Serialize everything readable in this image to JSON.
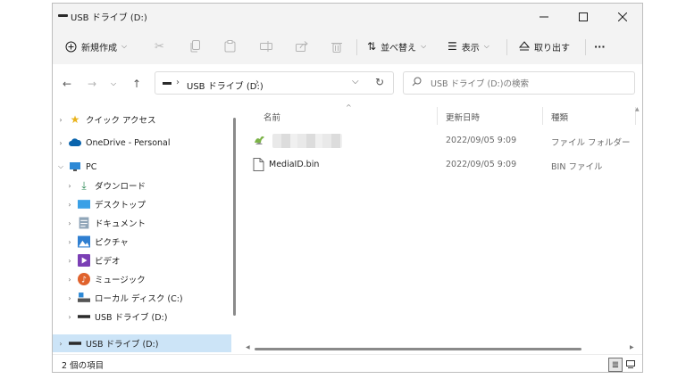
{
  "window": {
    "title": "USB ドライブ (D:)"
  },
  "toolbar": {
    "new_label": "新規作成",
    "sort_label": "並べ替え",
    "view_label": "表示",
    "eject_label": "取り出す",
    "more_label": "···"
  },
  "address": {
    "path": "USB ドライブ (D:)"
  },
  "search": {
    "placeholder": "USB ドライブ (D:)の検索"
  },
  "sidebar": {
    "items": [
      {
        "label": "クイック アクセス",
        "icon": "star-icon"
      },
      {
        "label": "OneDrive - Personal",
        "icon": "cloud-icon"
      },
      {
        "label": "PC",
        "icon": "monitor-icon"
      },
      {
        "label": "ダウンロード",
        "icon": "download-icon"
      },
      {
        "label": "デスクトップ",
        "icon": "desktop-icon"
      },
      {
        "label": "ドキュメント",
        "icon": "document-icon"
      },
      {
        "label": "ピクチャ",
        "icon": "picture-icon"
      },
      {
        "label": "ビデオ",
        "icon": "video-icon"
      },
      {
        "label": "ミュージック",
        "icon": "music-icon"
      },
      {
        "label": "ローカル ディスク (C:)",
        "icon": "local-disk-icon"
      },
      {
        "label": "USB ドライブ (D:)",
        "icon": "usb-drive-icon"
      },
      {
        "label": "USB ドライブ (D:)",
        "icon": "usb-drive-icon"
      }
    ]
  },
  "columns": {
    "name": "名前",
    "date": "更新日時",
    "type": "種類"
  },
  "files": [
    {
      "name": "",
      "date": "2022/09/05 9:09",
      "type": "ファイル フォルダー"
    },
    {
      "name": "MediaID.bin",
      "date": "2022/09/05 9:09",
      "type": "BIN ファイル"
    }
  ],
  "status": {
    "count": "2 個の項目"
  },
  "colors": {
    "selection": "#cce4f7",
    "accent": "#0a64ad"
  }
}
